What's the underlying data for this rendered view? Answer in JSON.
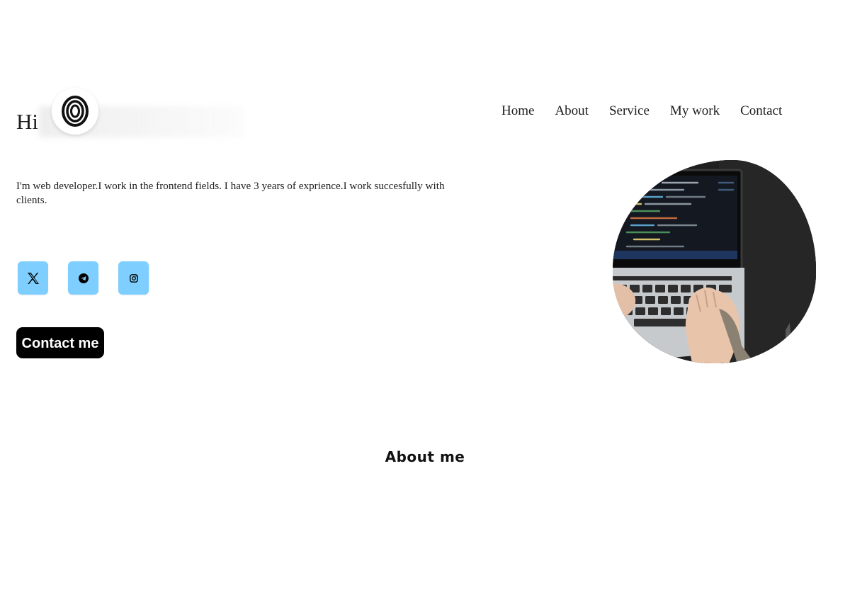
{
  "header": {
    "greeting": "Hi",
    "logo_icon": "fingerprint-oval-logo-icon",
    "nav": [
      {
        "label": "Home"
      },
      {
        "label": "About"
      },
      {
        "label": "Service"
      },
      {
        "label": "My work"
      },
      {
        "label": "Contact"
      }
    ]
  },
  "hero": {
    "intro": "I'm web developer.I work in the frontend fields. I have 3 years of exprience.I work succesfully with clients.",
    "socials": [
      {
        "icon": "x-twitter-icon"
      },
      {
        "icon": "telegram-icon"
      },
      {
        "icon": "instagram-icon"
      }
    ],
    "contact_button": "Contact me",
    "image_subject": "laptop-typing-image"
  },
  "about": {
    "title": "About me"
  },
  "colors": {
    "social_bg": "#7ecfff",
    "button_bg": "#000000",
    "button_text": "#ffffff"
  }
}
